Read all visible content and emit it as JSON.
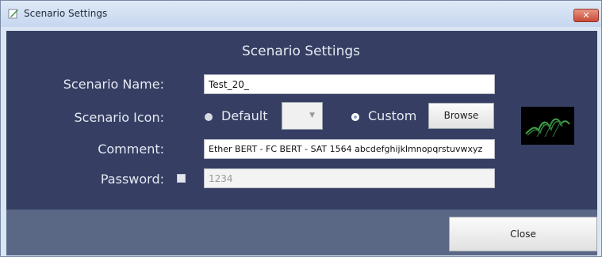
{
  "window": {
    "title": "Scenario Settings",
    "close_symbol": "✕",
    "title_icon": "pencil-document-icon"
  },
  "form": {
    "heading": "Scenario Settings",
    "name_label": "Scenario Name:",
    "name_value": "Test_20_",
    "icon_label": "Scenario Icon:",
    "default_label": "Default",
    "custom_label": "Custom",
    "selected_option": "Custom",
    "browse_label": "Browse",
    "comment_label": "Comment:",
    "comment_value": "Ether BERT - FC BERT - SAT 1564 abcdefghijklmnopqrstuvwxyz",
    "password_label": "Password:",
    "password_value": "1234",
    "password_checked": false,
    "preview_icon": "green-wave-graph-icon"
  },
  "footer": {
    "close_label": "Close"
  },
  "colors": {
    "panel": "#363f63",
    "footer": "#5a6886",
    "preview_accent": "#3fa14a"
  }
}
